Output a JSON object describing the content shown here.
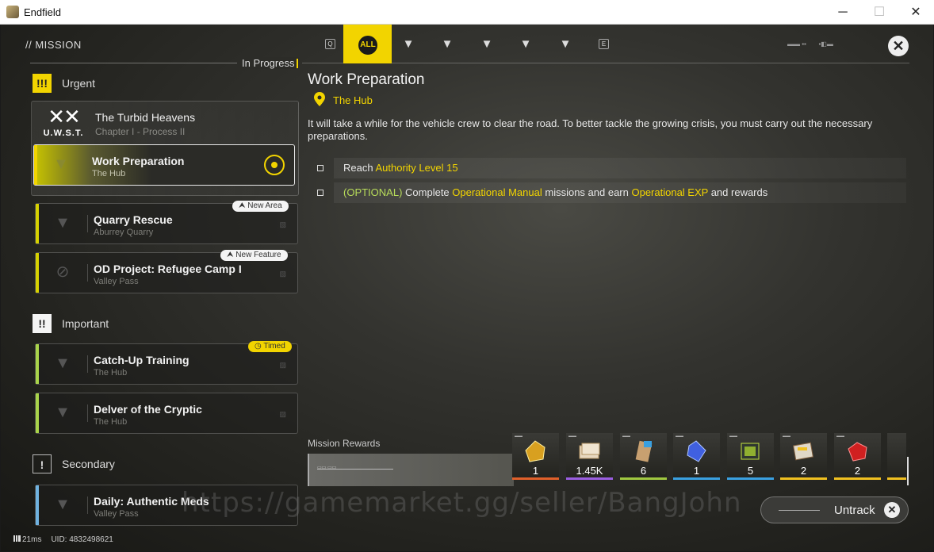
{
  "window": {
    "title": "Endfield",
    "minimize": "─",
    "maximize": "☐",
    "close": "✕"
  },
  "header": {
    "title": "// MISSION",
    "filters": [
      {
        "label": "Q",
        "icon": "q-icon",
        "active": false
      },
      {
        "label": "ALL",
        "icon": "all-icon",
        "active": true
      },
      {
        "label": "▼",
        "icon": "main-icon",
        "active": false
      },
      {
        "label": "▼",
        "icon": "side-icon",
        "active": false
      },
      {
        "label": "▼",
        "icon": "urgent-icon",
        "active": false
      },
      {
        "label": "▼",
        "icon": "important-icon",
        "active": false
      },
      {
        "label": "▼",
        "icon": "event-icon",
        "active": false
      },
      {
        "label": "E",
        "icon": "e-icon",
        "active": false
      }
    ],
    "close_label": "✕"
  },
  "list": {
    "in_progress": "In Progress",
    "urgent": {
      "label": "Urgent",
      "icon_text": "!!!",
      "group": {
        "logo": "U.W.S.T.",
        "title": "The Turbid Heavens",
        "subtitle": "Chapter I - Process II"
      },
      "quests": [
        {
          "title": "Work Preparation",
          "location": "The Hub",
          "selected": true
        },
        {
          "title": "Quarry Rescue",
          "location": "Aburrey Quarry",
          "badge": "New Area"
        },
        {
          "title": "OD Project: Refugee Camp I",
          "location": "Valley Pass",
          "badge": "New Feature"
        }
      ]
    },
    "important": {
      "label": "Important",
      "icon_text": "!!",
      "quests": [
        {
          "title": "Catch-Up Training",
          "location": "The Hub",
          "badge": "Timed"
        },
        {
          "title": "Delver of the Cryptic",
          "location": "The Hub"
        }
      ]
    },
    "secondary": {
      "label": "Secondary",
      "icon_text": "!",
      "quests": [
        {
          "title": "Daily: Authentic Meds",
          "location": "Valley Pass"
        }
      ]
    }
  },
  "detail": {
    "title": "Work Preparation",
    "location": "The Hub",
    "description": "It will take a while for the vehicle crew to clear the road. To better tackle the growing crisis, you must carry out the necessary preparations.",
    "objectives": {
      "o1_prefix": "Reach ",
      "o1_hl": "Authority Level 15",
      "o2_optional": "(OPTIONAL)",
      "o2_a": " Complete ",
      "o2_hl1": "Operational Manual",
      "o2_b": " missions and earn ",
      "o2_hl2": "Operational EXP",
      "o2_c": " and rewards"
    },
    "rewards_label": "Mission Rewards",
    "rewards": [
      {
        "qty": "1",
        "icon": "gold-crystal-icon",
        "rarity_color": "#e0602a"
      },
      {
        "qty": "1.45K",
        "icon": "tickets-icon",
        "rarity_color": "#9a5ee0"
      },
      {
        "qty": "6",
        "icon": "exp-card-icon",
        "rarity_color": "#a0c840"
      },
      {
        "qty": "1",
        "icon": "blue-crystal-icon",
        "rarity_color": "#3aa0e0"
      },
      {
        "qty": "5",
        "icon": "device-icon",
        "rarity_color": "#3aa0e0"
      },
      {
        "qty": "2",
        "icon": "manual-icon",
        "rarity_color": "#f0c020"
      },
      {
        "qty": "2",
        "icon": "red-crystal-icon",
        "rarity_color": "#f0c020"
      }
    ],
    "untrack_label": "Untrack"
  },
  "watermark": "https://gamemarket.gg/seller/BangJohn",
  "status": {
    "latency": "21ms",
    "uid": "UID: 4832498621"
  }
}
